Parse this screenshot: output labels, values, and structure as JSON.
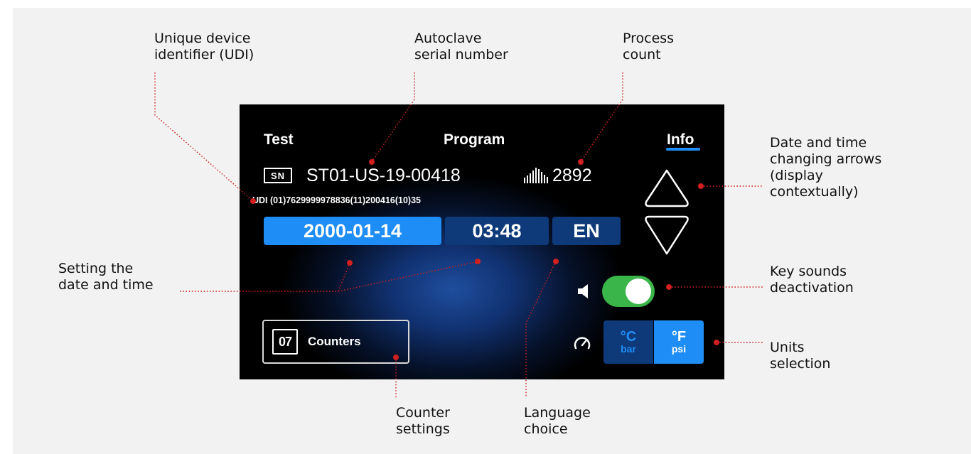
{
  "callouts": {
    "udi": "Unique device\nidentifier (UDI)",
    "serial": "Autoclave\nserial number",
    "process": "Process\ncount",
    "arrows": "Date and time\nchanging arrows\n(display\ncontextually)",
    "datetime": "Setting the\ndate and time",
    "sounds": "Key sounds\ndeactivation",
    "units": "Units\nselection",
    "counter_settings": "Counter\nsettings",
    "language": "Language\nchoice"
  },
  "screen": {
    "tabs": [
      "Test",
      "Program",
      "Info"
    ],
    "active_tab": "Info",
    "sn_badge": "SN",
    "serial_number": "ST01-US-19-00418",
    "process_count": "2892",
    "udi": "UDI (01)7629999978836(11)200416(10)35",
    "date": "2000-01-14",
    "time": "03:48",
    "language": "EN",
    "counters_icon": "07",
    "counters_label": "Counters",
    "units": {
      "celsius": "°C",
      "bar": "bar",
      "fahrenheit": "°F",
      "psi": "psi",
      "selected": "°F psi"
    },
    "key_sound_on": true
  },
  "colors": {
    "accent": "#1e8df5",
    "dark_field": "#0e3a7a",
    "toggle_green": "#39b54a",
    "leader_red": "#d21f1f",
    "background": "#f2f2f2"
  },
  "icons": [
    "up-arrow-icon",
    "down-arrow-icon",
    "speaker-icon",
    "gauge-icon",
    "bars-icon",
    "counter-icon"
  ]
}
